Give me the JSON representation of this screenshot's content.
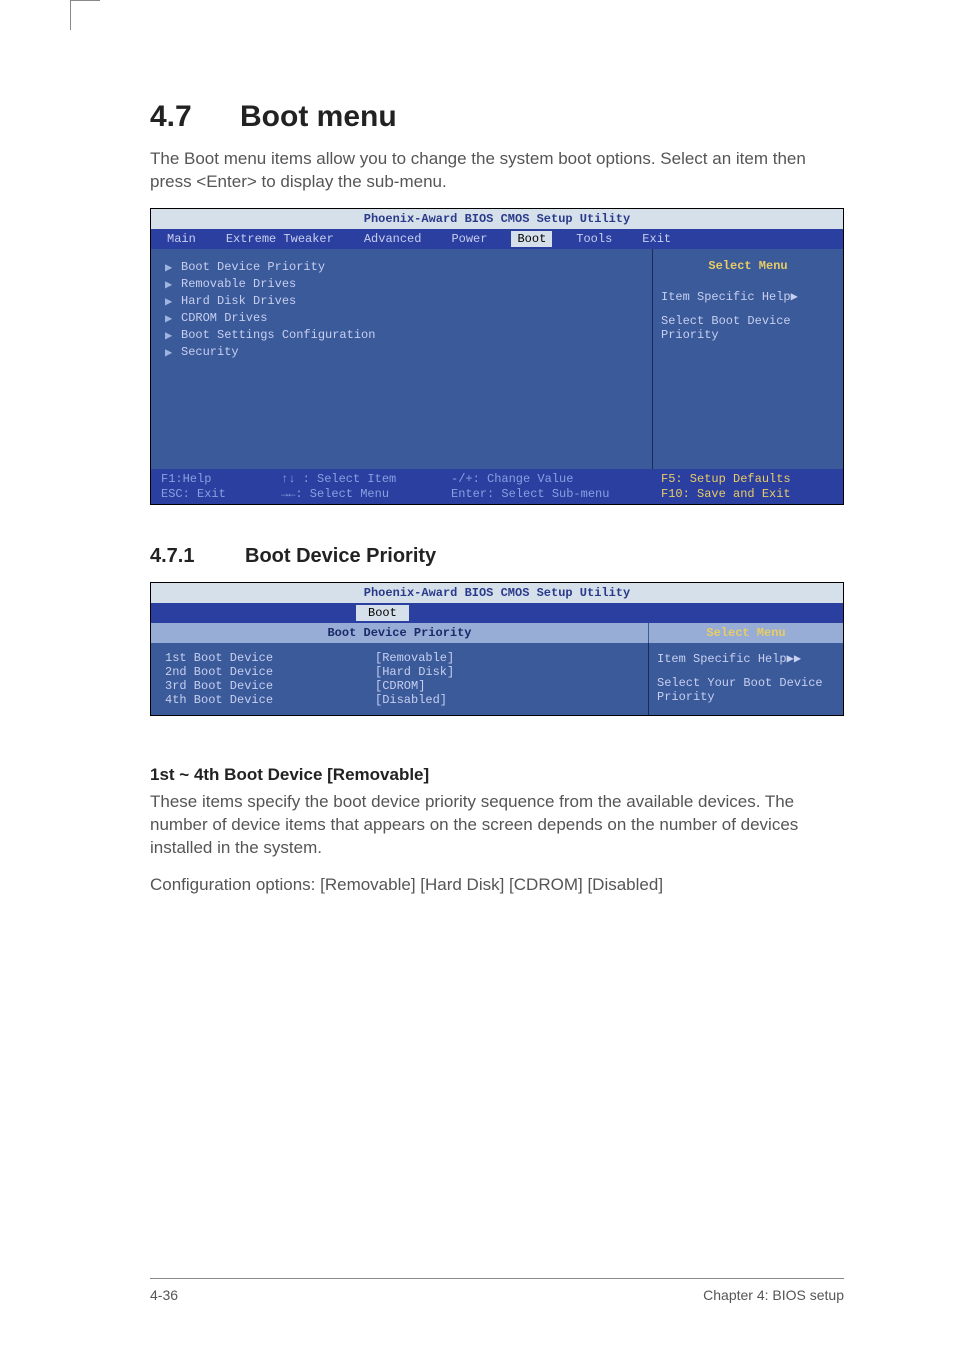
{
  "section": {
    "number": "4.7",
    "title": "Boot menu",
    "intro": "The Boot menu items allow you to change the system boot options. Select an item then press <Enter> to display the sub-menu."
  },
  "bios1": {
    "title": "Phoenix-Award BIOS CMOS Setup Utility",
    "tabs": [
      "Main",
      "Extreme Tweaker",
      "Advanced",
      "Power",
      "Boot",
      "Tools",
      "Exit"
    ],
    "items": [
      "Boot Device Priority",
      "Removable Drives",
      "Hard Disk Drives",
      "CDROM Drives",
      "Boot Settings Configuration",
      "Security"
    ],
    "right_title": "Select Menu",
    "right_help1": "Item Specific Help",
    "right_help2": "Select Boot Device Priority",
    "footer": {
      "f1a": "F1:Help",
      "f1b": "ESC: Exit",
      "f2a": "↑↓ : Select Item",
      "f2b": "→←: Select Menu",
      "f3a": "-/+: Change Value",
      "f3b": "Enter: Select Sub-menu",
      "f4a": "F5: Setup Defaults",
      "f4b": "F10: Save and Exit"
    }
  },
  "subsection": {
    "number": "4.7.1",
    "title": "Boot Device Priority"
  },
  "bios2": {
    "title": "Phoenix-Award BIOS CMOS Setup Utility",
    "tab": "Boot",
    "subhead_left": "Boot Device Priority",
    "subhead_right": "Select Menu",
    "rows": [
      {
        "label": "1st Boot Device",
        "value": "[Removable]"
      },
      {
        "label": "2nd Boot Device",
        "value": "[Hard Disk]"
      },
      {
        "label": "3rd Boot Device",
        "value": "[CDROM]"
      },
      {
        "label": "4th Boot Device",
        "value": "[Disabled]"
      }
    ],
    "right_help1": "Item Specific Help",
    "right_help2": "Select Your Boot Device Priority"
  },
  "para": {
    "title": "1st ~ 4th Boot Device [Removable]",
    "body1": "These items specify the boot device priority sequence from the available devices. The number of device items that appears on the screen depends on the number of devices installed in the system.",
    "body2": "Configuration options: [Removable] [Hard Disk] [CDROM] [Disabled]"
  },
  "footer": {
    "page": "4-36",
    "chapter": "Chapter 4: BIOS setup"
  }
}
